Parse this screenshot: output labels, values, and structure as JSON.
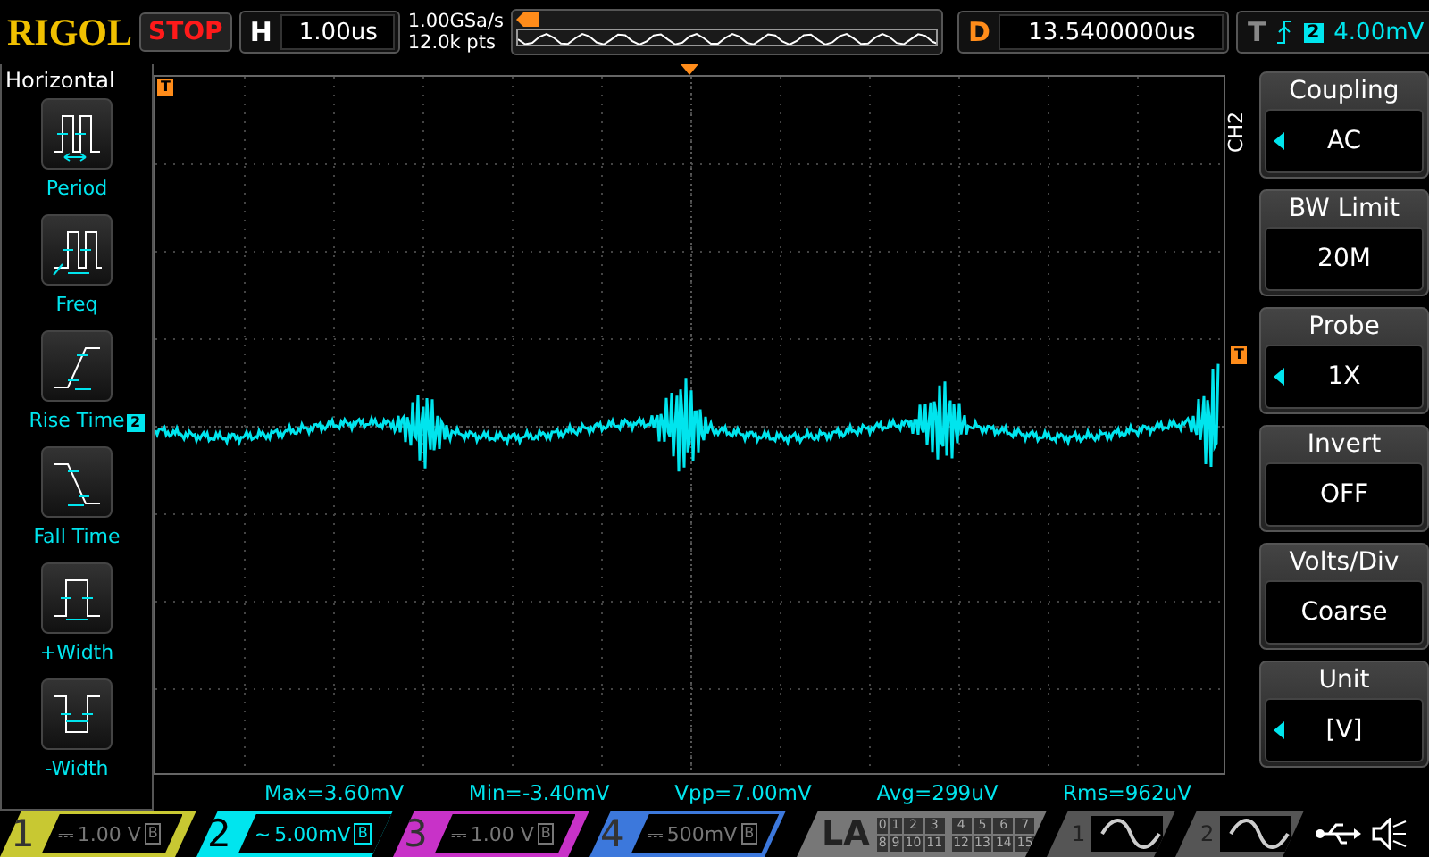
{
  "header": {
    "brand": "RIGOL",
    "run_state": "STOP",
    "timebase": {
      "label": "H",
      "value": "1.00us"
    },
    "sample_rate": "1.00GSa/s",
    "memory_depth": "12.0k pts",
    "delay": {
      "label": "D",
      "value": "13.5400000us"
    },
    "trigger": {
      "label": "T",
      "channel": "2",
      "level": "4.00mV"
    }
  },
  "left_menu": {
    "title": "Horizontal",
    "items": [
      {
        "kind": "period",
        "label": "Period",
        "selected": false
      },
      {
        "kind": "freq",
        "label": "Freq",
        "selected": false
      },
      {
        "kind": "rise",
        "label": "Rise Time",
        "selected": false
      },
      {
        "kind": "fall",
        "label": "Fall Time",
        "selected": false
      },
      {
        "kind": "pwidth",
        "label": "+Width",
        "selected": false
      },
      {
        "kind": "nwidth",
        "label": "-Width",
        "selected": false
      }
    ]
  },
  "scope": {
    "trigger_marker": "T",
    "top_marker": "T",
    "channel_marker": "2"
  },
  "right_menu": {
    "channel": "CH2",
    "items": [
      {
        "title": "Coupling",
        "value": "AC",
        "adjustable": true
      },
      {
        "title": "BW Limit",
        "value": "20M",
        "adjustable": false
      },
      {
        "title": "Probe",
        "value": "1X",
        "adjustable": true
      },
      {
        "title": "Invert",
        "value": "OFF",
        "adjustable": false
      },
      {
        "title": "Volts/Div",
        "value": "Coarse",
        "adjustable": false
      },
      {
        "title": "Unit",
        "value": "[V]",
        "adjustable": true
      }
    ]
  },
  "measurements": [
    "Max=3.60mV",
    "Min=-3.40mV",
    "Vpp=7.00mV",
    "Avg=299uV",
    "Rms=962uV"
  ],
  "channels": [
    {
      "number": "1",
      "coupling": "⎓",
      "scale": "1.00 V",
      "bw": "B",
      "active": false,
      "color": "#c8c832"
    },
    {
      "number": "2",
      "coupling": "~",
      "scale": "5.00mV",
      "bw": "B",
      "active": true,
      "color": "#00e5ee"
    },
    {
      "number": "3",
      "coupling": "⎓",
      "scale": "1.00 V",
      "bw": "B",
      "active": false,
      "color": "#c832c8"
    },
    {
      "number": "4",
      "coupling": "⎓",
      "scale": "500mV",
      "bw": "B",
      "active": false,
      "color": "#3c78dc"
    }
  ],
  "logic": {
    "label": "LA",
    "bits": [
      [
        "0",
        "1",
        "2",
        "3"
      ],
      [
        "4",
        "5",
        "6",
        "7"
      ],
      [
        "8",
        "9",
        "10",
        "11"
      ],
      [
        "12",
        "13",
        "14",
        "15"
      ]
    ]
  },
  "generators": [
    {
      "number": "1"
    },
    {
      "number": "2"
    }
  ]
}
